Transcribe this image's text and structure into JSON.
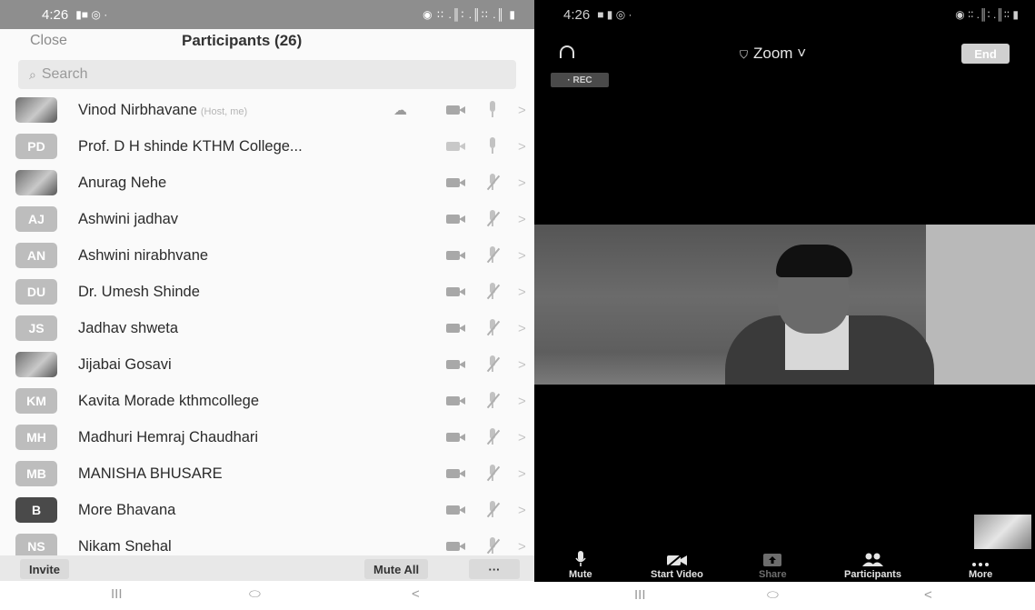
{
  "left_phone": {
    "status": {
      "time": "4:26",
      "icons": "▮■ ◎ ·",
      "right_icons": "◉ ∶∶ .║∶ .║∶∶ .║ ▮"
    },
    "header": {
      "close": "Close",
      "title": "Participants (26)"
    },
    "search": {
      "icon": "⌕",
      "placeholder": "Search"
    },
    "participants": [
      {
        "name": "Vinod Nirbhavane",
        "tag": "(Host, me)",
        "initials": "",
        "avatar": "photo",
        "cloud": true,
        "cam_light": false
      },
      {
        "name": "Prof. D  H  shinde KTHM College...",
        "tag": "",
        "initials": "PD",
        "avatar": "initials",
        "cloud": false,
        "cam_light": true
      },
      {
        "name": "Anurag Nehe",
        "tag": "",
        "initials": "",
        "avatar": "photo",
        "cloud": false,
        "cam_light": false
      },
      {
        "name": "Ashwini jadhav",
        "tag": "",
        "initials": "AJ",
        "avatar": "initials",
        "cloud": false,
        "cam_light": false
      },
      {
        "name": "Ashwini nirabhvane",
        "tag": "",
        "initials": "AN",
        "avatar": "initials",
        "cloud": false,
        "cam_light": false
      },
      {
        "name": "Dr. Umesh Shinde",
        "tag": "",
        "initials": "DU",
        "avatar": "initials",
        "cloud": false,
        "cam_light": false
      },
      {
        "name": "Jadhav shweta",
        "tag": "",
        "initials": "JS",
        "avatar": "initials",
        "cloud": false,
        "cam_light": false
      },
      {
        "name": "Jijabai Gosavi",
        "tag": "",
        "initials": "",
        "avatar": "photo",
        "cloud": false,
        "cam_light": false
      },
      {
        "name": "Kavita Morade kthmcollege",
        "tag": "",
        "initials": "KM",
        "avatar": "initials",
        "cloud": false,
        "cam_light": false
      },
      {
        "name": "Madhuri Hemraj Chaudhari",
        "tag": "",
        "initials": "MH",
        "avatar": "initials",
        "cloud": false,
        "cam_light": false
      },
      {
        "name": "MANISHA BHUSARE",
        "tag": "",
        "initials": "MB",
        "avatar": "initials",
        "cloud": false,
        "cam_light": false
      },
      {
        "name": "More Bhavana",
        "tag": "",
        "initials": "B",
        "avatar": "dark",
        "cloud": false,
        "cam_light": false
      },
      {
        "name": "Nikam Snehal",
        "tag": "",
        "initials": "NS",
        "avatar": "initials",
        "cloud": false,
        "cam_light": false
      }
    ],
    "bottom": {
      "invite": "Invite",
      "mute_all": "Mute All",
      "more": "···"
    },
    "nav": {
      "recents": "III",
      "home": "⬭",
      "back": "<"
    }
  },
  "right_phone": {
    "status": {
      "time": "4:26",
      "icons": "■ ▮ ◎ ·",
      "right_icons": "◉ ∶∶ .║∶ .║∶∶ ▮"
    },
    "header": {
      "shield": "⛉",
      "title": "Zoom ˅",
      "end": "End"
    },
    "rec": "· REC",
    "toolbar": [
      {
        "label": "Mute",
        "icon": "mic-icon",
        "dim": false
      },
      {
        "label": "Start Video",
        "icon": "video-off-icon",
        "dim": false
      },
      {
        "label": "Share",
        "icon": "share-icon",
        "dim": true
      },
      {
        "label": "Participants",
        "icon": "participants-icon",
        "dim": false
      },
      {
        "label": "More",
        "icon": "more-icon",
        "dim": false
      }
    ],
    "nav": {
      "recents": "III",
      "home": "⬭",
      "back": "<"
    }
  }
}
